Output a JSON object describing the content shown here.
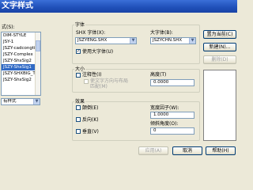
{
  "window": {
    "title": "文字样式"
  },
  "styles_label": "式(S):",
  "styles": [
    {
      "name": "DIM-STYLE"
    },
    {
      "name": "JSY-1"
    },
    {
      "name": "JSZY-cadcongti"
    },
    {
      "name": "JSZY-Complex"
    },
    {
      "name": "JSZY-ShxSig2"
    },
    {
      "name": "JSZY-ShxSig1"
    },
    {
      "name": "JSZY-SHXBIG_T3"
    },
    {
      "name": "JSZY-ShxSig2"
    }
  ],
  "selected_style_index": 5,
  "filter": {
    "value": "有样式"
  },
  "font_group": {
    "title": "字体",
    "shx_label": "SHX 字体(X):",
    "shx_value": "JSZYENG.SHX",
    "bigfont_label": "大字体(B):",
    "bigfont_value": "JSZYCHN.SHX",
    "use_bigfont_label": "使用大字体(U)",
    "use_bigfont_checked": true
  },
  "size_group": {
    "title": "大小",
    "annotative_label": "注释性(I)",
    "match_orientation_label": "使文字方向与布局",
    "match_layout_suffix": "匹配(M)",
    "height_label": "高度(T)",
    "height_value": "0.0000"
  },
  "effects_group": {
    "title": "效果",
    "upside_down_label": "颠倒(E)",
    "backwards_label": "反向(K)",
    "vertical_label": "垂直(V)",
    "width_factor_label": "宽度因子(W):",
    "width_factor_value": "1.0000",
    "oblique_label": "倾斜角度(O):",
    "oblique_value": "0"
  },
  "buttons": {
    "set_current": "置为当前(C)",
    "new": "新建(N)...",
    "delete": "删除(D)",
    "apply": "应用(A)",
    "cancel": "取消",
    "help": "帮助(H)"
  },
  "colors": {
    "selection": "#316ac5",
    "titlebar": "#1f4fb8",
    "dialog_bg": "#ece9d8"
  }
}
